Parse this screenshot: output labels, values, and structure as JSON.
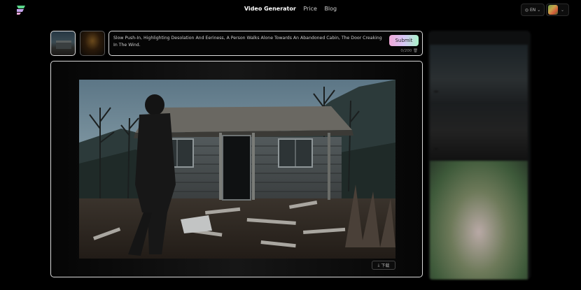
{
  "header": {
    "nav": [
      {
        "label": "Video Generator",
        "active": true
      },
      {
        "label": "Price",
        "active": false
      },
      {
        "label": "Blog",
        "active": false
      }
    ],
    "language": "EN",
    "logo_colors": [
      "#5ad68a",
      "#c7a5f0",
      "#f0a9d8"
    ]
  },
  "prompt": {
    "text": "Slow Push-In, Highlighting Desolation And Eeriness, A Person Walks Alone Towards An Abandoned Cabin, The Door Creaking In The Wind.",
    "submit_label": "Submit",
    "counter": "0/200",
    "trash_icon": "trash-icon"
  },
  "preview": {
    "download_label": "下载",
    "download_icon": "download-icon"
  },
  "colors": {
    "border_active": "#d9d9d9",
    "submit_gradient": [
      "#f0a9d8",
      "#d6c6f5",
      "#a9f3c9"
    ]
  }
}
